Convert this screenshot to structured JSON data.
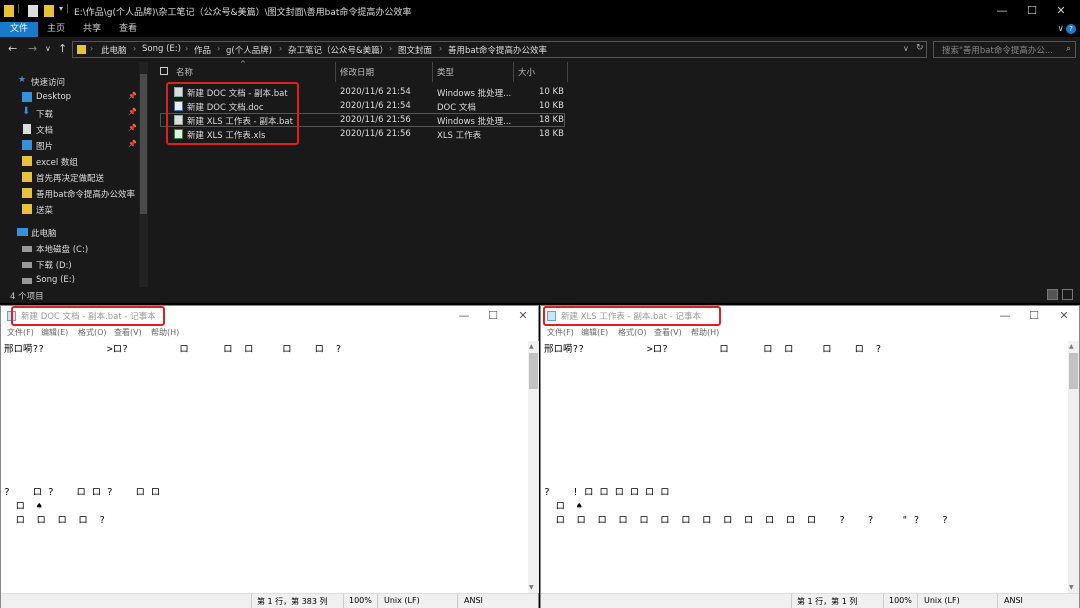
{
  "explorer": {
    "title": "E:\\作品\\g(个人品牌)\\杂工笔记（公众号&美篇）\\图文封面\\善用bat命令提高办公效率",
    "window_buttons": {
      "minimize": "—",
      "maximize": "☐",
      "close": "✕"
    },
    "ribbon_tabs": [
      "文件",
      "主页",
      "共享",
      "查看"
    ],
    "nav_buttons": {
      "back": "←",
      "forward": "→",
      "recent": "∨",
      "up": "↑"
    },
    "breadcrumbs": [
      "此电脑",
      "Song (E:)",
      "作品",
      "g(个人品牌)",
      "杂工笔记（公众号&美篇）",
      "图文封面",
      "善用bat命令提高办公效率"
    ],
    "search_placeholder": "搜索\"善用bat命令提高办公...",
    "nav_pane": {
      "quick_access": "快速访问",
      "items": [
        {
          "label": "Desktop",
          "icon": "desktop-icon",
          "pinned": true
        },
        {
          "label": "下载",
          "icon": "download-icon",
          "pinned": true
        },
        {
          "label": "文档",
          "icon": "documents-icon",
          "pinned": true
        },
        {
          "label": "图片",
          "icon": "pictures-icon",
          "pinned": true
        },
        {
          "label": "excel 数组",
          "icon": "folder-icon",
          "pinned": false
        },
        {
          "label": "首先再决定做配送",
          "icon": "folder-icon",
          "pinned": false
        },
        {
          "label": "善用bat命令提高办公效率",
          "icon": "folder-icon",
          "pinned": false
        },
        {
          "label": "送菜",
          "icon": "folder-icon",
          "pinned": false
        }
      ],
      "this_pc": "此电脑",
      "drives": [
        {
          "label": "本地磁盘 (C:)",
          "icon": "drive-icon"
        },
        {
          "label": "下载 (D:)",
          "icon": "drive-icon"
        },
        {
          "label": "Song (E:)",
          "icon": "drive-icon"
        }
      ]
    },
    "columns": {
      "name": "名称",
      "modified": "修改日期",
      "type": "类型",
      "size": "大小"
    },
    "files": [
      {
        "name": "新建 DOC 文档 - 副本.bat",
        "modified": "2020/11/6 21:54",
        "type": "Windows 批处理...",
        "size": "10 KB",
        "kind": "bat"
      },
      {
        "name": "新建 DOC 文档.doc",
        "modified": "2020/11/6 21:54",
        "type": "DOC 文档",
        "size": "10 KB",
        "kind": "doc"
      },
      {
        "name": "新建 XLS 工作表 - 副本.bat",
        "modified": "2020/11/6 21:56",
        "type": "Windows 批处理...",
        "size": "18 KB",
        "kind": "bat"
      },
      {
        "name": "新建 XLS 工作表.xls",
        "modified": "2020/11/6 21:56",
        "type": "XLS 工作表",
        "size": "18 KB",
        "kind": "xls"
      }
    ],
    "status": "4 个项目"
  },
  "notepad_left": {
    "title": "新建 DOC 文档 - 副本.bat - 记事本",
    "menu": [
      "文件(F)",
      "编辑(E)",
      "格式(O)",
      "查看(V)",
      "帮助(H)"
    ],
    "lines": [
      "邢ロ嗬??           >ロ?         ロ      ロ  ロ     ロ    ロ  ?",
      "",
      "",
      "",
      "",
      "",
      "",
      "",
      "",
      "?    ロ ?    ロ ロ ?    ロ ロ",
      "  ロ  ♠",
      "  ロ  ロ  ロ  ロ  ?"
    ],
    "status": {
      "pos": "第 1 行，第 383 列",
      "zoom": "100%",
      "eol": "Unix (LF)",
      "enc": "ANSI"
    }
  },
  "notepad_right": {
    "title": "新建 XLS 工作表 - 副本.bat - 记事本",
    "menu": [
      "文件(F)",
      "编辑(E)",
      "格式(O)",
      "查看(V)",
      "帮助(H)"
    ],
    "lines": [
      "邢ロ嗬??           >ロ?         ロ      ロ  ロ     ロ    ロ  ?",
      "",
      "",
      "",
      "",
      "",
      "",
      "",
      "",
      "?    ! ロ ロ ロ ロ ロ ロ",
      "  ロ  ♠",
      "  ロ  ロ  ロ  ロ  ロ  ロ  ロ  ロ  ロ  ロ  ロ  ロ  ロ    ?    ?     \" ?    ?"
    ],
    "status": {
      "pos": "第 1 行，第 1 列",
      "zoom": "100%",
      "eol": "Unix (LF)",
      "enc": "ANSI"
    }
  },
  "colors": {
    "accent": "#1979ca",
    "highlight": "#e0201c",
    "dark_bg": "#191919"
  }
}
